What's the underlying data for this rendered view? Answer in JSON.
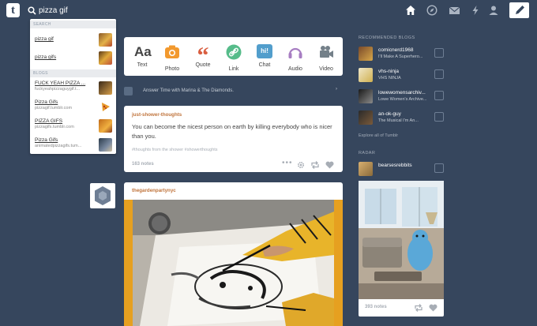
{
  "header": {
    "logo": "t",
    "search_value": "pizza gif",
    "icons": [
      "home-icon",
      "compass-icon",
      "mail-icon",
      "lightning-icon",
      "account-icon",
      "pencil-icon"
    ]
  },
  "search_dropdown": {
    "search_heading": "SEARCH",
    "search_items": [
      {
        "label": "pizza gif"
      },
      {
        "label": "pizza gifs"
      }
    ],
    "blogs_heading": "BLOGS",
    "blog_items": [
      {
        "title": "FUCK YEAH PIZZA ...",
        "url": "fuckyeahpizzaguygif.t..."
      },
      {
        "title": "Pizza Gifs",
        "url": "pizzagif.tumblr.com"
      },
      {
        "title": "PIZZA GIFS",
        "url": "pizzagifs.tumblr.com"
      },
      {
        "title": "Pizza Gifs",
        "url": "animatedpizzagifs.tum..."
      }
    ]
  },
  "post_types": [
    {
      "label": "Text",
      "glyph": "Aa",
      "color": "#444444"
    },
    {
      "label": "Photo",
      "color": "#f2992e"
    },
    {
      "label": "Quote",
      "glyph": "“",
      "color": "#d95e40"
    },
    {
      "label": "Link",
      "color": "#56bc8a"
    },
    {
      "label": "Chat",
      "glyph": "hi!",
      "color": "#529ecc"
    },
    {
      "label": "Audio",
      "color": "#a77dc2"
    },
    {
      "label": "Video",
      "color": "#748089"
    }
  ],
  "radar_line": "Answer Time with Marina & The Diamonds.",
  "posts": [
    {
      "blog": "just-shower-thoughts",
      "text": "You can become the nicest person on earth by killing everybody who is nicer than you.",
      "tags": "#thoughts from the shower   #showerthoughts",
      "notes": "163 notes"
    },
    {
      "blog": "thegardenpartynyc"
    }
  ],
  "sidebar": {
    "recommended_title": "RECOMMENDED BLOGS",
    "blogs": [
      {
        "name": "comicnerd1968",
        "desc": "I'll Make A Superhero..."
      },
      {
        "name": "vhs-ninja",
        "desc": "VHS NINJA"
      },
      {
        "name": "lowewomensarchiv...",
        "desc": "Lowe Women's Archive..."
      },
      {
        "name": "an-ok-guy",
        "desc": "The Musical I'm An..."
      }
    ],
    "explore": "Explore all of Tumblr",
    "radar_title": "RADAR",
    "radar_blog": "bearsesrebbits",
    "radar_notes": "393 notes"
  },
  "colors": {
    "background": "#36465d",
    "accent": "#c0743c",
    "link": "#56bc8a"
  }
}
